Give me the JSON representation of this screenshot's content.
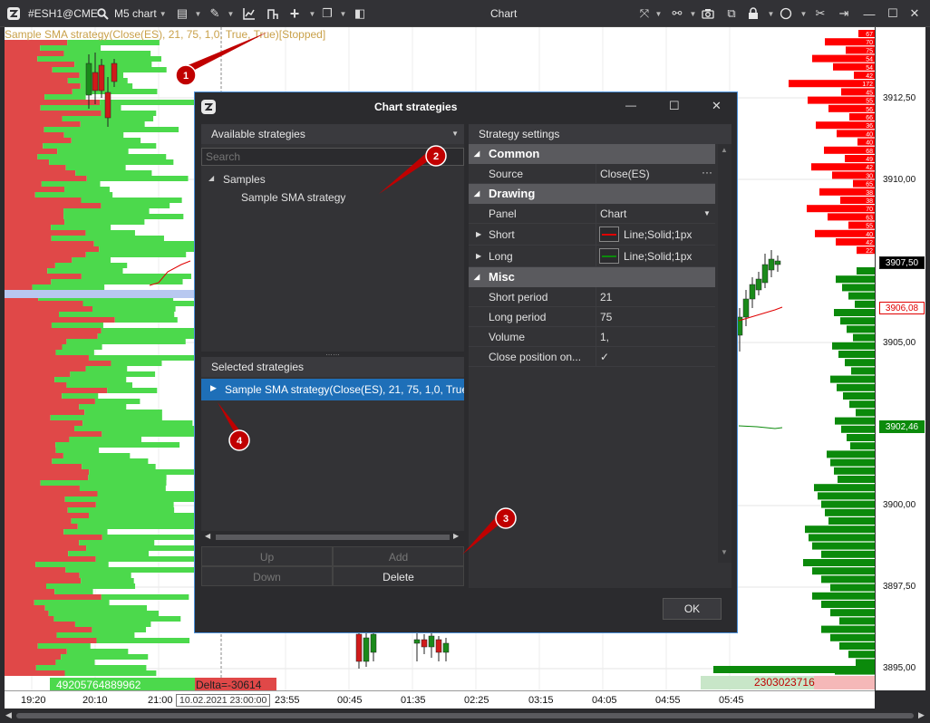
{
  "toolbar": {
    "symbol": "#ESH1@CME",
    "chart_type": "M5 chart",
    "window_title": "Chart"
  },
  "chart": {
    "strategy_label": "Sample SMA strategy(Close(ES), 21, 75, 1,0, True, True)[Stopped]",
    "price_ticks": [
      "3912,50",
      "3910,00",
      "3905,00",
      "3900,00",
      "3897,50",
      "3895,00"
    ],
    "price_labels": {
      "current": "3907,50",
      "red_line": "3906,08",
      "green_line": "3902,46"
    },
    "time_ticks": [
      "19:20",
      "20:10",
      "21:00",
      "23:55",
      "00:45",
      "01:35",
      "02:25",
      "03:15",
      "04:05",
      "04:55",
      "05:45"
    ],
    "crosshair_time": "10.02.2021 23:00:00",
    "volume_total": "49205764889962",
    "delta": "Delta=-30614",
    "right_total": "2303023716",
    "right_profile_numbers": [
      "67",
      "70",
      "75",
      "54",
      "54",
      "42",
      "172",
      "45",
      "55",
      "56",
      "66",
      "36",
      "40",
      "40",
      "68",
      "49",
      "42",
      "30",
      "65",
      "38",
      "38",
      "70",
      "63",
      "55",
      "40",
      "42",
      "22"
    ],
    "colors": {
      "bid": "#e04848",
      "ask": "#4cd94c",
      "profile_red": "#ff0000",
      "profile_green": "#0b8a0b",
      "strategy_label": "#c9a14a"
    }
  },
  "dialog": {
    "title": "Chart strategies",
    "available_header": "Available strategies",
    "search_placeholder": "Search",
    "tree_group": "Samples",
    "tree_item": "Sample SMA strategy",
    "selected_header": "Selected strategies",
    "selected_item": "Sample SMA strategy(Close(ES), 21, 75, 1,0, True, T",
    "buttons": {
      "up": "Up",
      "add": "Add",
      "down": "Down",
      "delete": "Delete",
      "ok": "OK"
    },
    "settings": {
      "header": "Strategy settings",
      "sections": {
        "common": "Common",
        "drawing": "Drawing",
        "misc": "Misc"
      },
      "rows": {
        "source": {
          "key": "Source",
          "value": "Close(ES)"
        },
        "panel": {
          "key": "Panel",
          "value": "Chart"
        },
        "short": {
          "key": "Short",
          "value": "Line;Solid;1px"
        },
        "long": {
          "key": "Long",
          "value": "Line;Solid;1px"
        },
        "short_period": {
          "key": "Short period",
          "value": "21"
        },
        "long_period": {
          "key": "Long period",
          "value": "75"
        },
        "volume": {
          "key": "Volume",
          "value": "1,"
        },
        "close_position": {
          "key": "Close position on...",
          "value": "✓"
        }
      }
    }
  },
  "annotations": [
    "1",
    "2",
    "3",
    "4"
  ]
}
